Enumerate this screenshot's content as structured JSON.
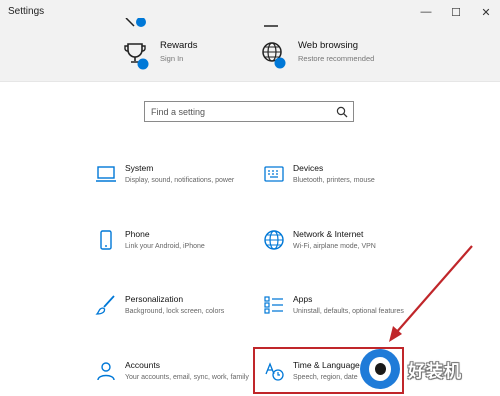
{
  "window": {
    "title": "Settings",
    "min_glyph": "—",
    "max_glyph": "☐",
    "close_glyph": "✕"
  },
  "header_tiles": [
    {
      "title": "Rewards",
      "subtitle": "Sign In"
    },
    {
      "title": "Web browsing",
      "subtitle": "Restore recommended"
    }
  ],
  "search": {
    "placeholder": "Find a setting"
  },
  "categories": [
    {
      "title": "System",
      "subtitle": "Display, sound, notifications, power",
      "icon": "laptop-icon"
    },
    {
      "title": "Devices",
      "subtitle": "Bluetooth, printers, mouse",
      "icon": "keyboard-icon"
    },
    {
      "title": "Phone",
      "subtitle": "Link your Android, iPhone",
      "icon": "phone-icon"
    },
    {
      "title": "Network & Internet",
      "subtitle": "Wi-Fi, airplane mode, VPN",
      "icon": "globe-icon"
    },
    {
      "title": "Personalization",
      "subtitle": "Background, lock screen, colors",
      "icon": "brush-icon"
    },
    {
      "title": "Apps",
      "subtitle": "Uninstall, defaults, optional features",
      "icon": "apps-list-icon"
    },
    {
      "title": "Accounts",
      "subtitle": "Your accounts, email, sync, work, family",
      "icon": "person-icon"
    },
    {
      "title": "Time & Language",
      "subtitle": "Speech, region, date",
      "icon": "time-language-icon"
    }
  ],
  "watermark": {
    "text": "好装机"
  },
  "colors": {
    "accent": "#0078d7",
    "annotation": "#c0262a",
    "watermark_blue": "#1f7bd8"
  }
}
